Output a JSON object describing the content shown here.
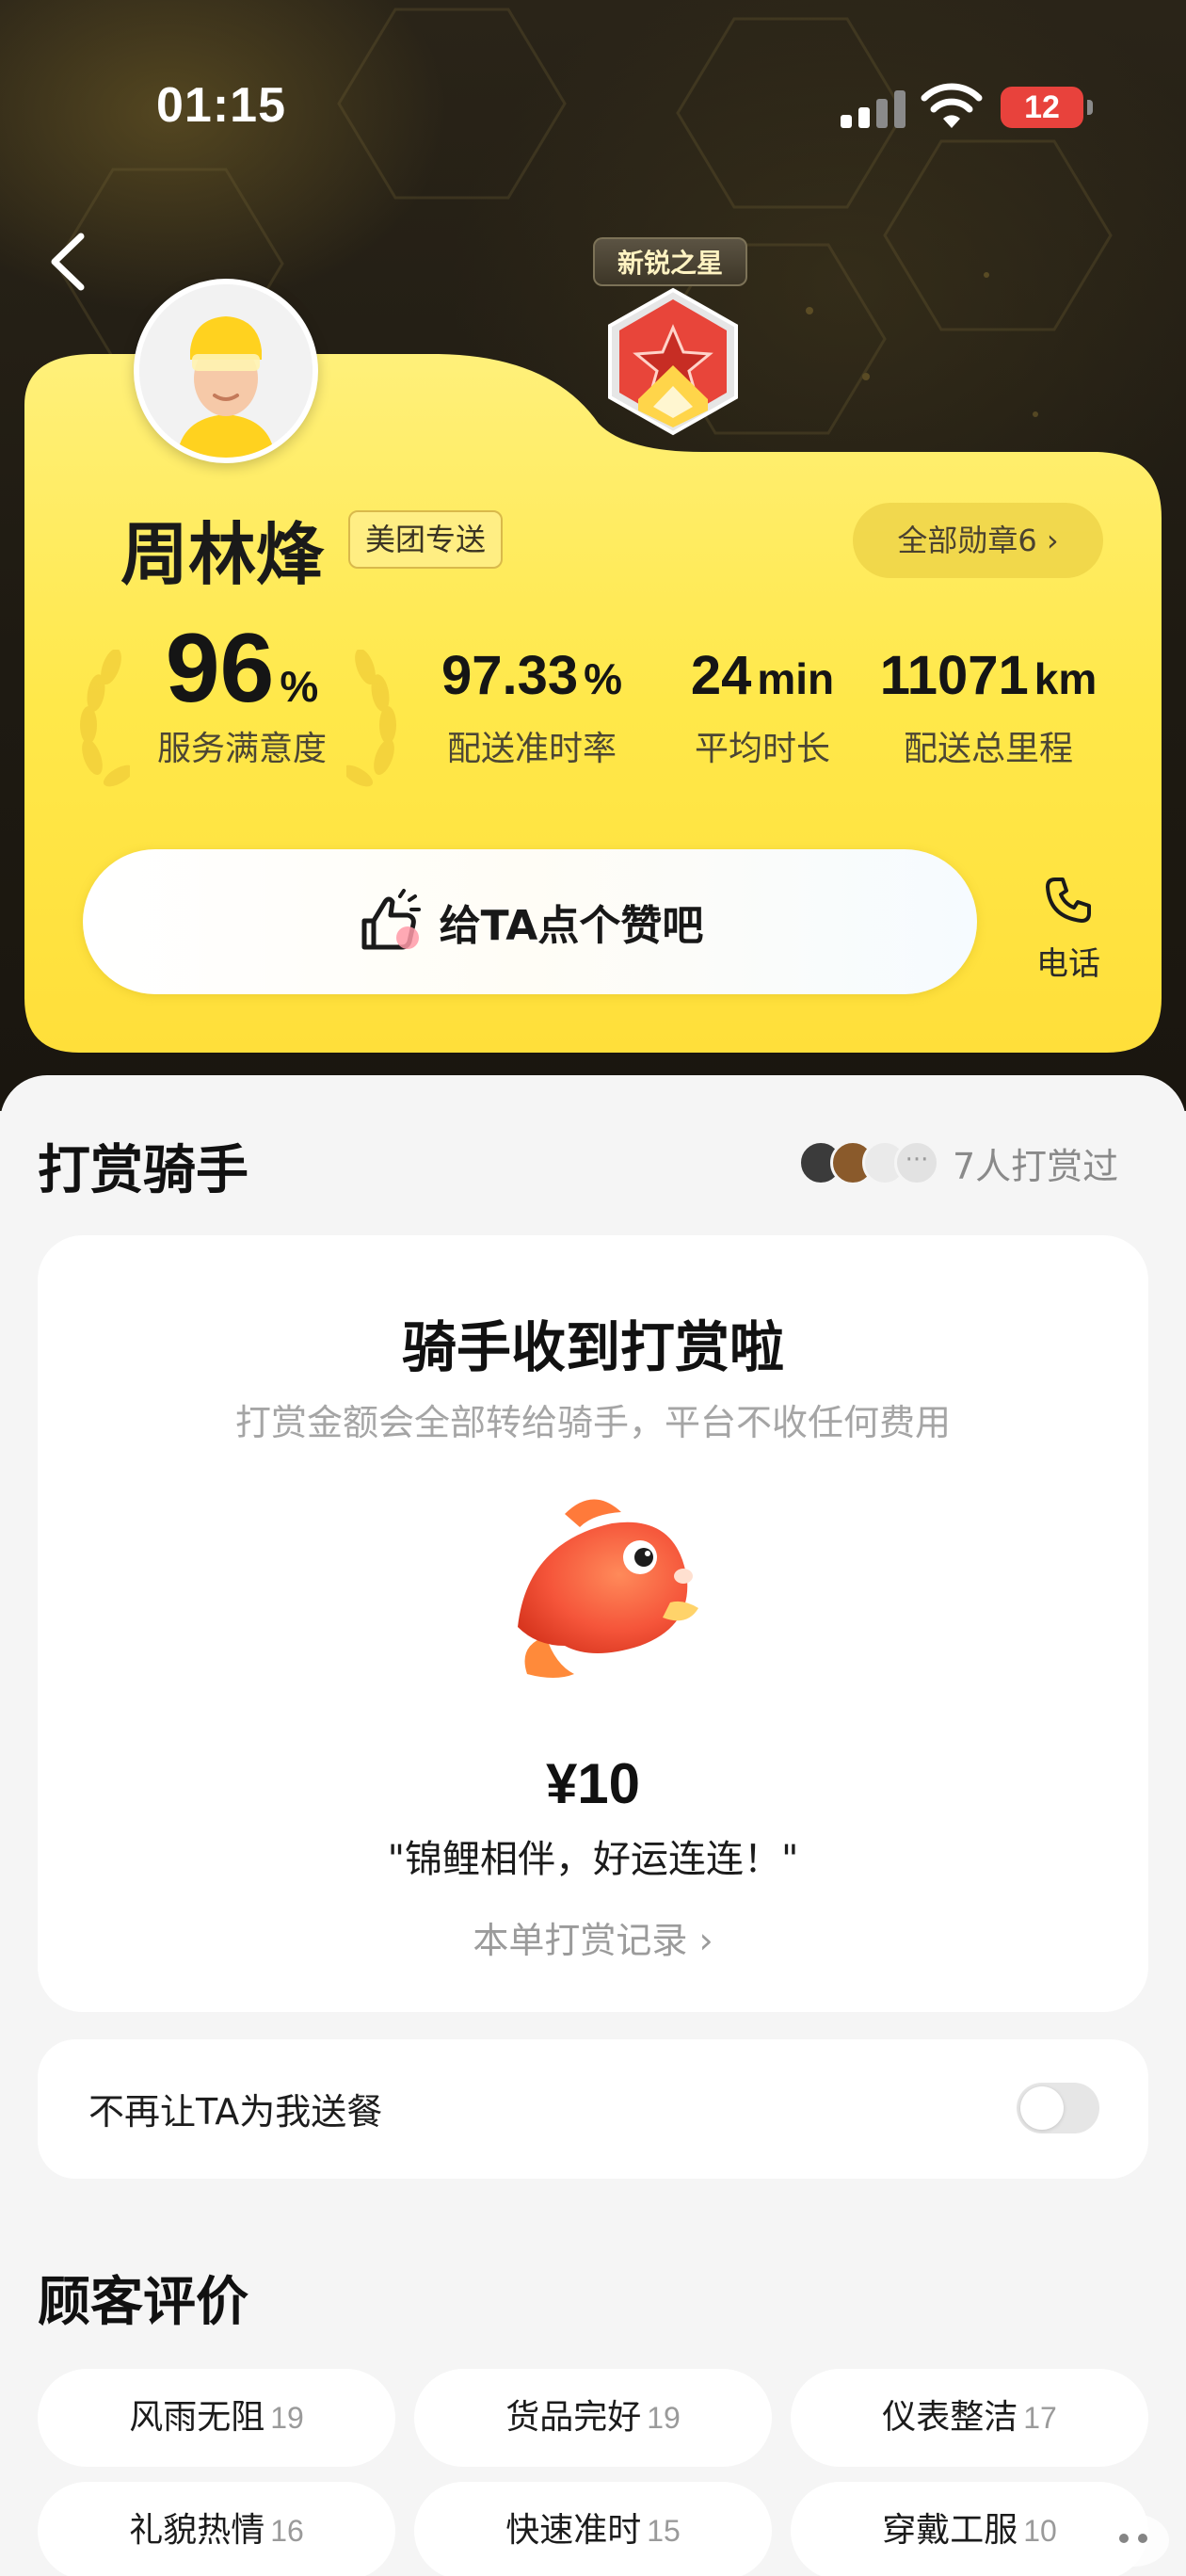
{
  "status_bar": {
    "time": "01:15",
    "battery_level": "12",
    "battery_color": "#e8423c"
  },
  "header": {
    "badge_title": "新锐之星",
    "rider_name": "周林烽",
    "delivery_tag": "美团专送",
    "all_badges_label": "全部勋章6 ›",
    "brand_yellow": "#ffe44a"
  },
  "stats": [
    {
      "value": "96",
      "unit": "%",
      "label": "服务满意度"
    },
    {
      "value": "97.33",
      "unit": "%",
      "label": "配送准时率"
    },
    {
      "value": "24",
      "unit": "min",
      "label": "平均时长"
    },
    {
      "value": "11071",
      "unit": "km",
      "label": "配送总里程"
    }
  ],
  "actions": {
    "like_label": "给TA点个赞吧",
    "phone_label": "电话"
  },
  "tip_section": {
    "title": "打赏骑手",
    "tipper_count_label": "7人打赏过",
    "card_title": "骑手收到打赏啦",
    "card_subtitle": "打赏金额会全部转给骑手，平台不收任何费用",
    "gift_icon": "koi-fish-icon",
    "amount": "¥10",
    "quote": "\"锦鲤相伴，好运连连！\"",
    "record_link": "本单打赏记录 ›"
  },
  "block_rider": {
    "label": "不再让TA为我送餐",
    "enabled": false
  },
  "reviews": {
    "title": "顾客评价",
    "tags": [
      {
        "label": "风雨无阻",
        "count": "19"
      },
      {
        "label": "货品完好",
        "count": "19"
      },
      {
        "label": "仪表整洁",
        "count": "17"
      },
      {
        "label": "礼貌热情",
        "count": "16"
      },
      {
        "label": "快速准时",
        "count": "15"
      },
      {
        "label": "穿戴工服",
        "count": "10"
      }
    ]
  }
}
